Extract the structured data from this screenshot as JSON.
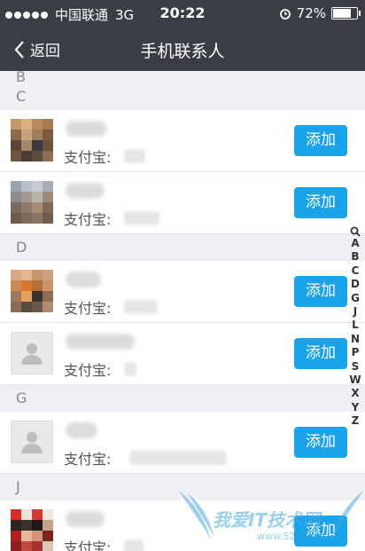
{
  "status": {
    "carrier": "中国联通",
    "network": "3G",
    "time": "20:22",
    "battery": "72%",
    "battery_level": 0.72
  },
  "nav": {
    "back_label": "返回",
    "title": "手机联系人"
  },
  "sections": {
    "B": "B",
    "C": "C",
    "D": "D",
    "G": "G",
    "J": "J"
  },
  "alipay_label": "支付宝:",
  "add_label": "添加",
  "index": [
    "A",
    "B",
    "C",
    "D",
    "G",
    "J",
    "L",
    "N",
    "P",
    "S",
    "W",
    "X",
    "Y",
    "Z"
  ],
  "watermark": {
    "text": "我爱IT技术网",
    "url": "www.52ij.com"
  }
}
